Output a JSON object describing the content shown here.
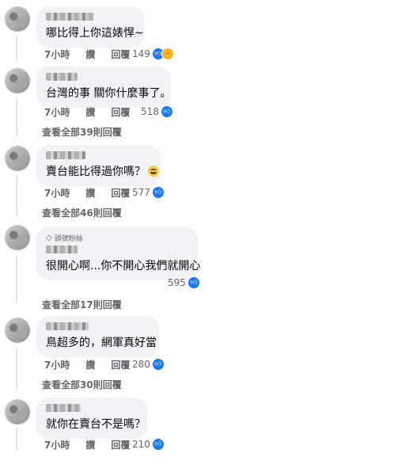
{
  "comments": [
    {
      "text": "哪比得上你這婊悍~",
      "time": "7小時",
      "like": "讚",
      "reply": "回覆",
      "count": "149"
    },
    {
      "text": "台灣的事 關你什麼事了。",
      "time": "7小時",
      "like": "讚",
      "reply": "回覆",
      "count": "518",
      "view_replies": "查看全部39則回覆"
    },
    {
      "text": "賣台能比得過你嗎？",
      "time": "7小時",
      "like": "讚",
      "reply": "回覆",
      "count": "577",
      "view_replies": "查看全部46則回覆"
    },
    {
      "badge": "頭號粉絲",
      "text": "很開心啊...你不開心我們就開心",
      "time": "7小時",
      "like": "讚",
      "reply": "回覆",
      "count": "595",
      "view_replies": "查看全部17則回覆"
    },
    {
      "text": "鳥超多的，網軍真好當",
      "time": "7小時",
      "like": "讚",
      "reply": "回覆",
      "count": "280",
      "view_replies": "查看全部30則回覆"
    },
    {
      "text": "就你在賣台不是嗎？",
      "time": "7小時",
      "like": "讚",
      "reply": "回覆",
      "count": "210"
    }
  ],
  "colors": {
    "bubble": "#f0f2f5",
    "like_blue": "#1877f2",
    "meta_gray": "#65676b"
  },
  "icons": {
    "like": "thumbs-up-icon",
    "haha": "haha-icon"
  }
}
